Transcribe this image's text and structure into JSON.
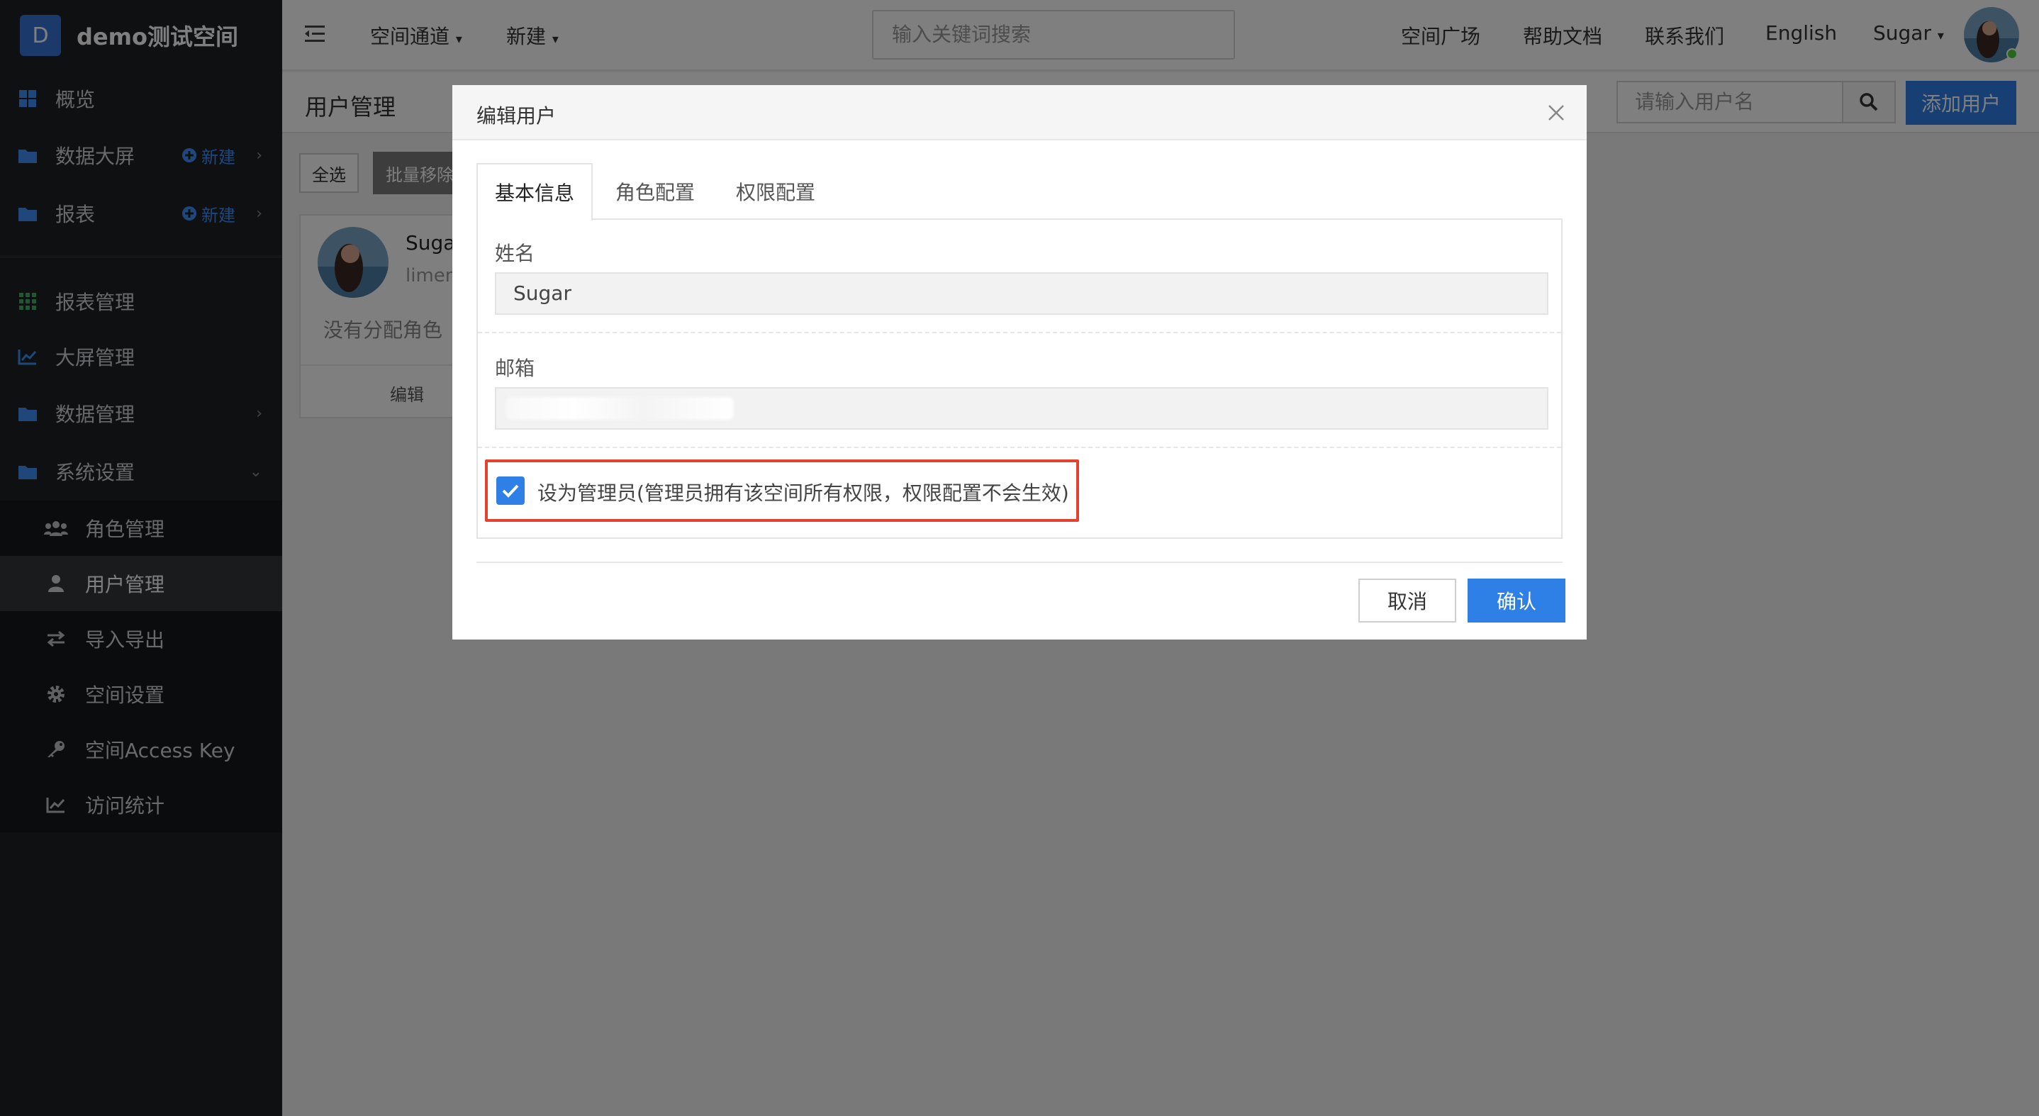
{
  "brand": {
    "logo_letter": "D",
    "name": "demo测试空间"
  },
  "sidebar": {
    "items": [
      {
        "label": "概览",
        "icon": "grid-icon"
      },
      {
        "label": "数据大屏",
        "icon": "folder-icon",
        "new_label": "新建"
      },
      {
        "label": "报表",
        "icon": "folder-icon",
        "new_label": "新建"
      },
      {
        "label": "报表管理",
        "icon": "apps-grid-icon"
      },
      {
        "label": "大屏管理",
        "icon": "line-chart-icon"
      },
      {
        "label": "数据管理",
        "icon": "folder-icon"
      },
      {
        "label": "系统设置",
        "icon": "folder-icon"
      }
    ],
    "subitems": [
      {
        "label": "角色管理",
        "icon": "users-icon"
      },
      {
        "label": "用户管理",
        "icon": "user-icon"
      },
      {
        "label": "导入导出",
        "icon": "swap-icon"
      },
      {
        "label": "空间设置",
        "icon": "gear-icon"
      },
      {
        "label": "空间Access Key",
        "icon": "key-icon"
      },
      {
        "label": "访问统计",
        "icon": "line-chart-icon"
      }
    ]
  },
  "header": {
    "space_channel": "空间通道",
    "new_label": "新建",
    "search_placeholder": "输入关键词搜索",
    "links": [
      "空间广场",
      "帮助文档",
      "联系我们",
      "English"
    ],
    "user_name": "Sugar"
  },
  "main": {
    "page_title": "用户管理",
    "user_search_placeholder": "请输入用户名",
    "add_user": "添加用户",
    "select_all": "全选",
    "batch_remove": "批量移除",
    "card": {
      "name": "Suga",
      "login": "limen",
      "role_text": "没有分配角色",
      "edit_label": "编辑"
    }
  },
  "modal": {
    "title": "编辑用户",
    "tabs": [
      "基本信息",
      "角色配置",
      "权限配置"
    ],
    "name_label": "姓名",
    "name_value": "Sugar",
    "email_label": "邮箱",
    "admin_checkbox_label": "设为管理员(管理员拥有该空间所有权限，权限配置不会生效)",
    "admin_checked": true,
    "cancel": "取消",
    "confirm": "确认"
  },
  "colors": {
    "primary": "#2e7fe6",
    "sidebar_bg": "#1f2124",
    "highlight_border": "#e5412f"
  }
}
